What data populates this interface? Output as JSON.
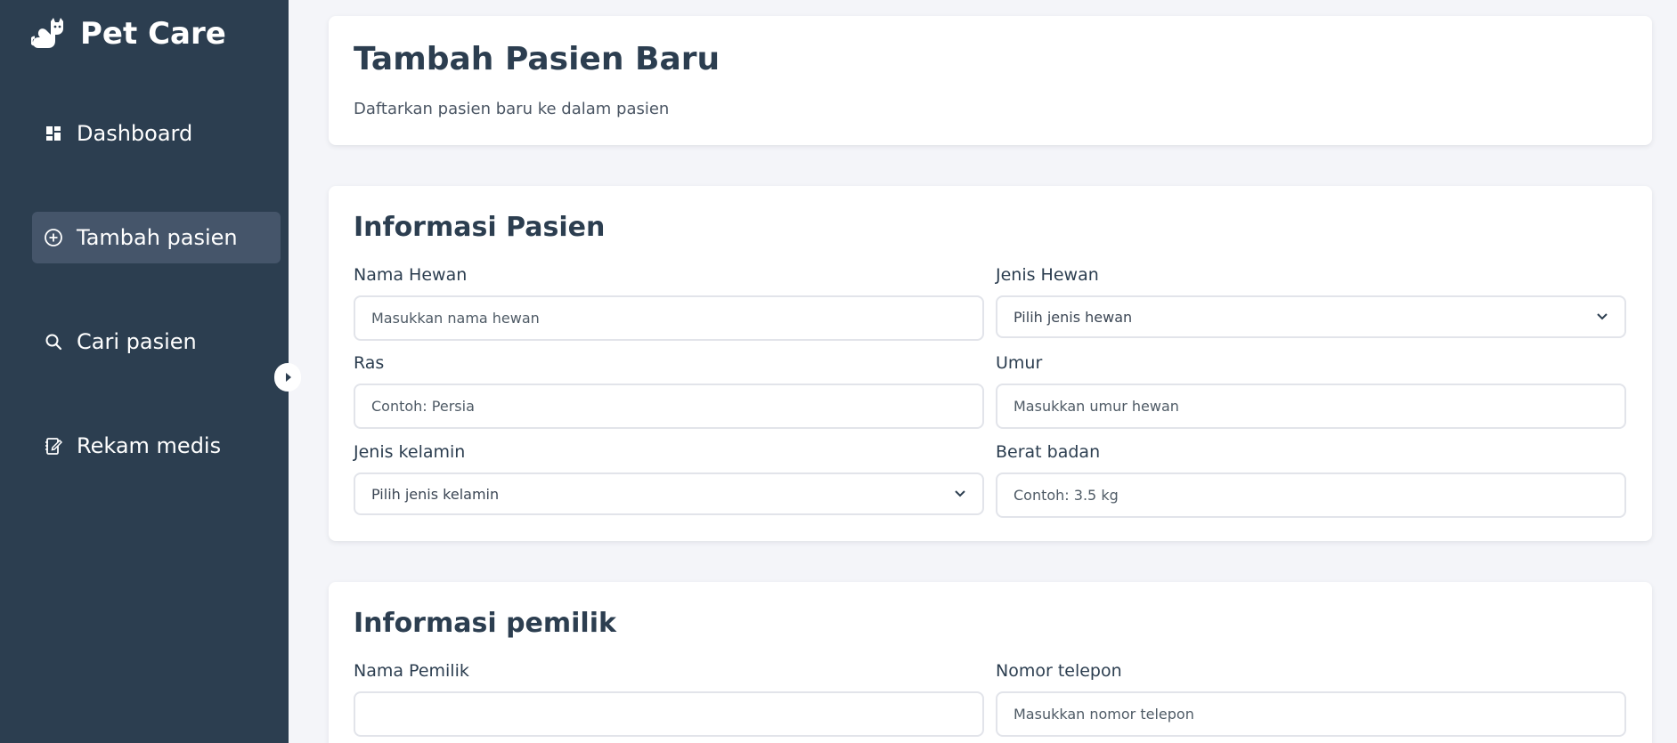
{
  "sidebar": {
    "brand": "Pet Care",
    "items": [
      {
        "label": "Dashboard",
        "icon": "dashboard-icon"
      },
      {
        "label": "Tambah pasien",
        "icon": "add-circle-icon",
        "active": true
      },
      {
        "label": "Cari pasien",
        "icon": "search-icon"
      },
      {
        "label": "Rekam medis",
        "icon": "medical-record-icon"
      }
    ]
  },
  "header": {
    "title": "Tambah Pasien Baru",
    "subtitle": "Daftarkan pasien baru ke dalam pasien"
  },
  "patient_section": {
    "title": "Informasi Pasien",
    "nama_hewan": {
      "label": "Nama Hewan",
      "placeholder": "Masukkan nama hewan",
      "value": ""
    },
    "jenis_hewan": {
      "label": "Jenis Hewan",
      "selected": "Pilih jenis hewan"
    },
    "ras": {
      "label": "Ras",
      "placeholder": "Contoh: Persia",
      "value": ""
    },
    "umur": {
      "label": "Umur",
      "placeholder": "Masukkan umur hewan",
      "value": ""
    },
    "jenis_kelamin": {
      "label": "Jenis kelamin",
      "selected": "Pilih jenis kelamin"
    },
    "berat_badan": {
      "label": "Berat badan",
      "placeholder": "Contoh: 3.5 kg",
      "value": ""
    }
  },
  "owner_section": {
    "title": "Informasi pemilik",
    "nama_pemilik": {
      "label": "Nama Pemilik",
      "placeholder": "",
      "value": ""
    },
    "nomor_telepon": {
      "label": "Nomor telepon",
      "placeholder": "Masukkan nomor telepon",
      "value": ""
    }
  },
  "colors": {
    "sidebar_bg": "#2c3e50",
    "active_item_bg": "#45556a",
    "page_bg": "#f4f5f9",
    "card_bg": "#ffffff",
    "heading_text": "#2c3e50"
  }
}
